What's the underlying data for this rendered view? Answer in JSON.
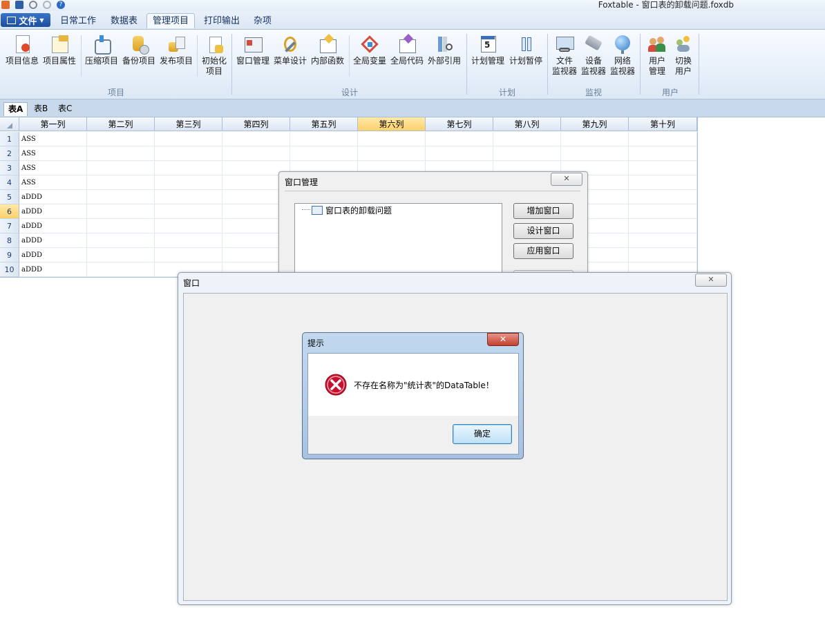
{
  "window": {
    "title": "Foxtable - 窗口表的卸载问题.foxdb"
  },
  "ribbon": {
    "file_label": "文件",
    "tabs": [
      {
        "label": "日常工作"
      },
      {
        "label": "数据表"
      },
      {
        "label": "管理项目"
      },
      {
        "label": "打印输出"
      },
      {
        "label": "杂项"
      }
    ],
    "groups": {
      "project": {
        "label": "项目",
        "buttons": [
          "项目信息",
          "项目属性",
          "压缩项目",
          "备份项目",
          "发布项目",
          "初始化",
          "项目"
        ]
      },
      "design": {
        "label": "设计",
        "buttons": [
          "窗口管理",
          "菜单设计",
          "内部函数",
          "全局变量",
          "全局代码",
          "外部引用"
        ]
      },
      "plan": {
        "label": "计划",
        "buttons": [
          "计划管理",
          "计划暂停"
        ]
      },
      "monitor": {
        "label": "监视",
        "buttons": [
          [
            "文件",
            "监视器"
          ],
          [
            "设备",
            "监视器"
          ],
          [
            "网络",
            "监视器"
          ]
        ]
      },
      "user": {
        "label": "用户",
        "buttons": [
          [
            "用户",
            "管理"
          ],
          [
            "切换",
            "用户"
          ]
        ]
      }
    }
  },
  "sheet_tabs": [
    "表A",
    "表B",
    "表C"
  ],
  "grid": {
    "columns": [
      "第一列",
      "第二列",
      "第三列",
      "第四列",
      "第五列",
      "第六列",
      "第七列",
      "第八列",
      "第九列",
      "第十列"
    ],
    "rows": [
      {
        "num": "1",
        "c1": "ASS"
      },
      {
        "num": "2",
        "c1": "ASS"
      },
      {
        "num": "3",
        "c1": "ASS"
      },
      {
        "num": "4",
        "c1": "ASS"
      },
      {
        "num": "5",
        "c1": "aDDD"
      },
      {
        "num": "6",
        "c1": "aDDD"
      },
      {
        "num": "7",
        "c1": "aDDD"
      },
      {
        "num": "8",
        "c1": "aDDD"
      },
      {
        "num": "9",
        "c1": "aDDD"
      },
      {
        "num": "10",
        "c1": "aDDD"
      }
    ]
  },
  "window_manager": {
    "title": "窗口管理",
    "tree_item": "窗口表的卸载问题",
    "add_label": "增加窗口",
    "design_label": "设计窗口",
    "apply_label": "应用窗口"
  },
  "form_window": {
    "title": "窗口"
  },
  "message_box": {
    "title": "提示",
    "text": "不存在名称为\"统计表\"的DataTable！",
    "ok_label": "确定"
  },
  "colors": {
    "accent": "#1d4e9e",
    "selected_header": "#fcd16b",
    "error_red": "#c8102e"
  }
}
